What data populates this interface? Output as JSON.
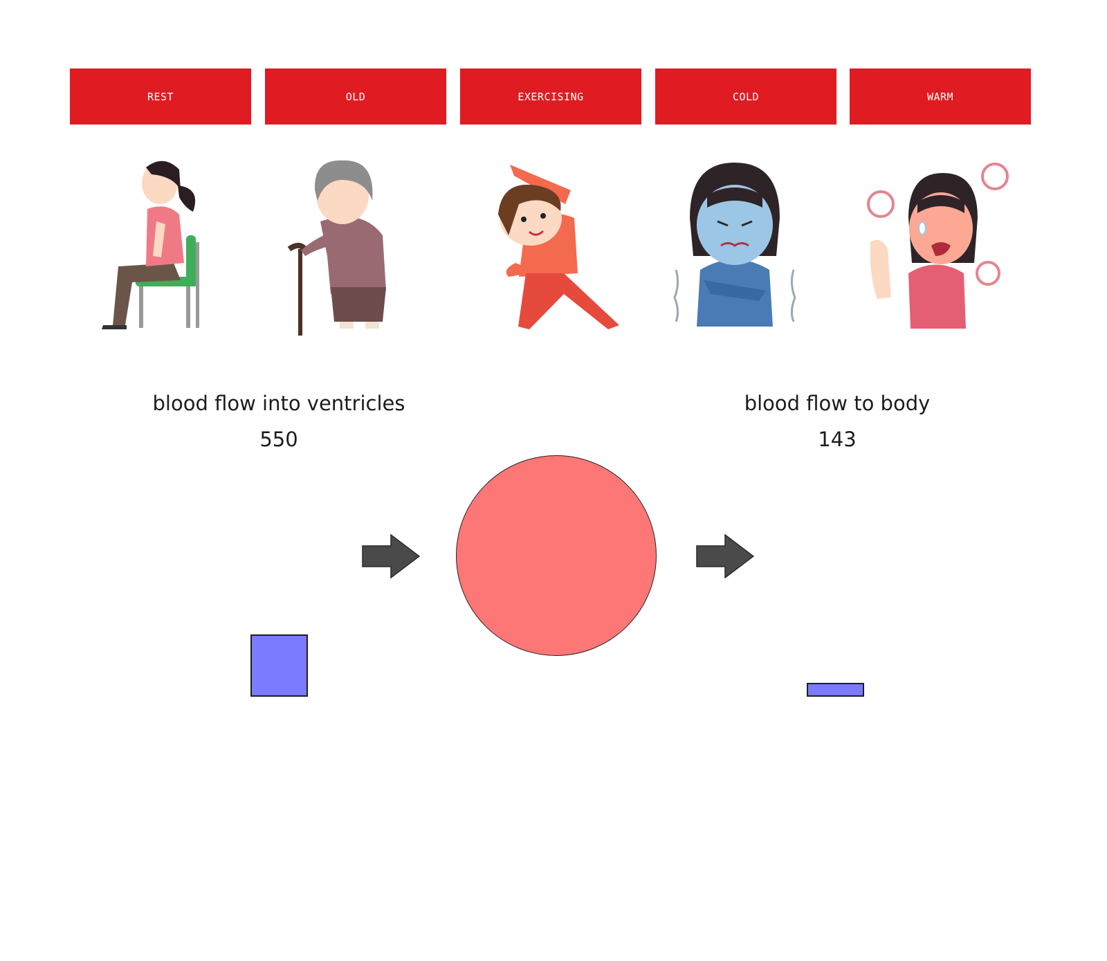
{
  "buttons": {
    "rest": "REST",
    "old": "OLD",
    "exercising": "EXERCISING",
    "cold": "COLD",
    "warm": "WARM"
  },
  "inflow": {
    "label": "blood flow into ventricles",
    "value": "550",
    "level": 550
  },
  "outflow": {
    "label": "blood flow to body",
    "value": "143",
    "level": 143
  },
  "colors": {
    "button_bg": "#e01c22",
    "button_text": "#ffffff",
    "heart_fill": "#fe7777",
    "bar_fill": "#7b7bff",
    "arrow_fill": "#4a4a4a"
  }
}
